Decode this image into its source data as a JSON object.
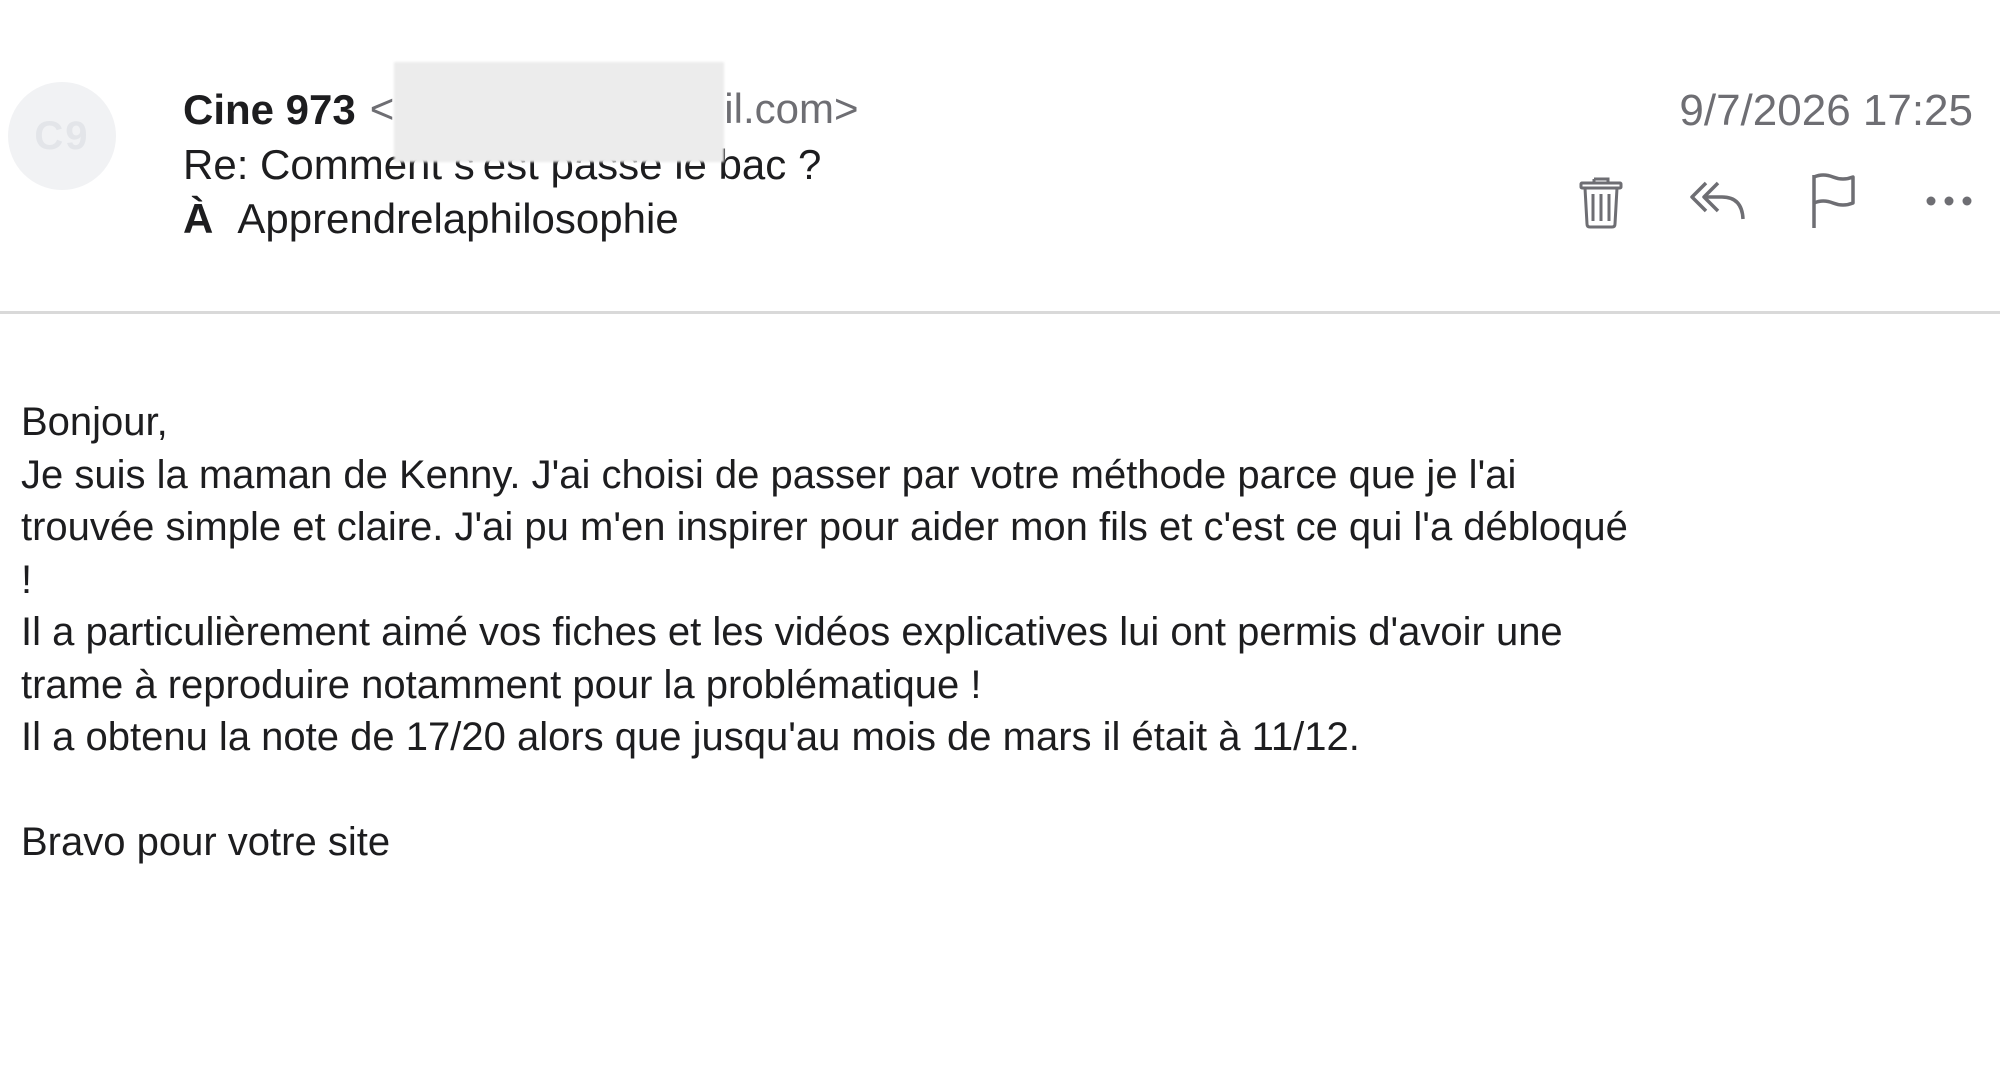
{
  "email": {
    "sender_initials": "C9",
    "sender_name": "Cine 973",
    "sender_email_open": "<",
    "sender_email_visible": "il.com>",
    "subject": "Re: Comment s'est passé le bac ?",
    "to_label": "À",
    "to_value": "Apprendrelaphilosophie",
    "date": "9/7/2026 17:25"
  },
  "toolbar": {
    "icons": [
      "trash-icon",
      "reply-all-icon",
      "flag-icon",
      "more-icon"
    ]
  },
  "body": {
    "greeting": "Bonjour,",
    "line1": "Je suis la maman de Kenny. J'ai choisi de passer par votre méthode parce que je l'ai",
    "line2": "trouvée simple et claire. J'ai pu m'en inspirer pour aider mon fils et c'est ce qui l'a débloqué",
    "line3": "!",
    "line4": "Il a particulièrement aimé vos fiches et les vidéos explicatives lui ont permis d'avoir une",
    "line5": "trame à reproduire notamment pour la problématique !",
    "line6": "Il a obtenu la note de 17/20 alors que jusqu'au mois de mars il était à 11/12.",
    "closing": "Bravo pour votre site"
  },
  "colors": {
    "text": "#1d1d1f",
    "secondary": "#6e6e73",
    "icon": "#6e6e73",
    "divider": "#d9d9d9"
  }
}
